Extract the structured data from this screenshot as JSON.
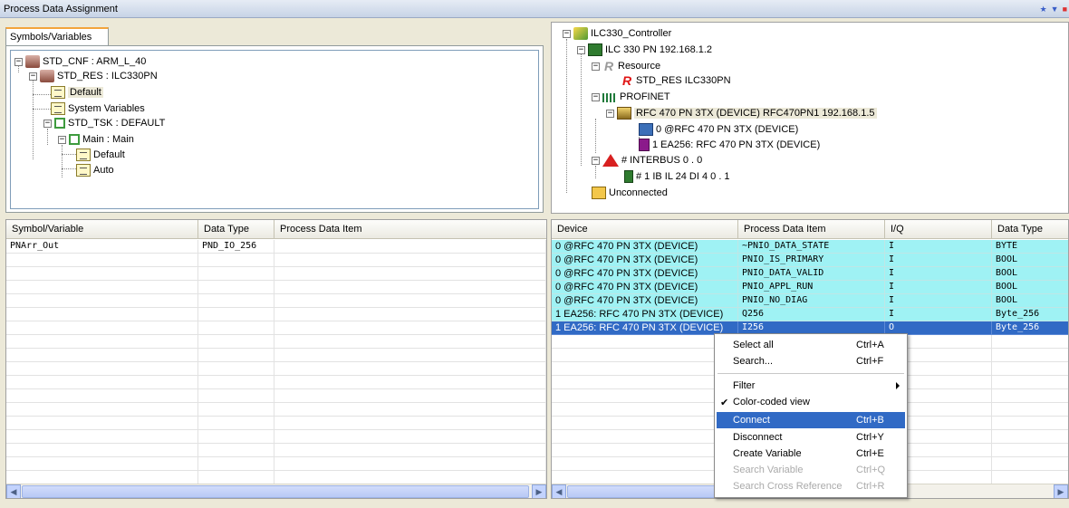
{
  "window": {
    "title": "Process Data Assignment"
  },
  "left_panel": {
    "tab": "Symbols/Variables",
    "tree": {
      "std_cnf": "STD_CNF : ARM_L_40",
      "std_res": "STD_RES : ILC330PN",
      "default": "Default",
      "system_variables": "System Variables",
      "std_tsk": "STD_TSK : DEFAULT",
      "main": "Main : Main",
      "main_default": "Default",
      "main_auto": "Auto"
    }
  },
  "right_tree": {
    "controller": "ILC330_Controller",
    "ilc": "ILC 330 PN 192.168.1.2",
    "resource": "Resource",
    "std_res": "STD_RES ILC330PN",
    "profinet": "PROFINET",
    "rfc_device": "RFC 470 PN 3TX (DEVICE) RFC470PN1 192.168.1.5",
    "rfc_sub0": "0 @RFC 470 PN 3TX (DEVICE)",
    "rfc_sub1": "1 EA256: RFC 470 PN 3TX (DEVICE)",
    "interbus": "# INTERBUS 0 . 0",
    "ib_module": "# 1 IB IL 24 DI 4 0 . 1",
    "unconnected": "Unconnected",
    "resource_letter": "R"
  },
  "left_grid": {
    "columns": [
      "Symbol/Variable",
      "Data Type",
      "Process Data Item"
    ],
    "rows": [
      [
        "PNArr_Out",
        "PND_IO_256",
        ""
      ]
    ]
  },
  "right_grid": {
    "columns": [
      "Device",
      "Process Data Item",
      "I/Q",
      "Data Type"
    ],
    "rows": [
      [
        "0 @RFC 470 PN 3TX (DEVICE)",
        "~PNIO_DATA_STATE",
        "I",
        "BYTE"
      ],
      [
        "0 @RFC 470 PN 3TX (DEVICE)",
        "PNIO_IS_PRIMARY",
        "I",
        "BOOL"
      ],
      [
        "0 @RFC 470 PN 3TX (DEVICE)",
        "PNIO_DATA_VALID",
        "I",
        "BOOL"
      ],
      [
        "0 @RFC 470 PN 3TX (DEVICE)",
        "PNIO_APPL_RUN",
        "I",
        "BOOL"
      ],
      [
        "0 @RFC 470 PN 3TX (DEVICE)",
        "PNIO_NO_DIAG",
        "I",
        "BOOL"
      ],
      [
        "1 EA256: RFC 470 PN 3TX (DEVICE)",
        "Q256",
        "I",
        "Byte_256"
      ],
      [
        "1 EA256: RFC 470 PN 3TX (DEVICE)",
        "I256",
        "O",
        "Byte_256"
      ]
    ]
  },
  "context_menu": {
    "select_all": {
      "label": "Select all",
      "shortcut": "Ctrl+A"
    },
    "search": {
      "label": "Search...",
      "shortcut": "Ctrl+F"
    },
    "filter": {
      "label": "Filter"
    },
    "color_coded": {
      "label": "Color-coded view"
    },
    "connect": {
      "label": "Connect",
      "shortcut": "Ctrl+B"
    },
    "disconnect": {
      "label": "Disconnect",
      "shortcut": "Ctrl+Y"
    },
    "create_variable": {
      "label": "Create Variable",
      "shortcut": "Ctrl+E"
    },
    "search_variable": {
      "label": "Search Variable",
      "shortcut": "Ctrl+Q"
    },
    "search_cross_ref": {
      "label": "Search Cross Reference",
      "shortcut": "Ctrl+R"
    }
  },
  "colors": {
    "highlight": "#316ac5",
    "cyan_rows": "#9ff2f4"
  }
}
